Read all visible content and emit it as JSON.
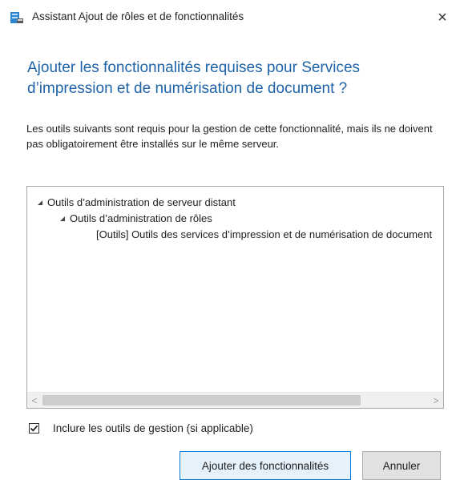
{
  "window": {
    "title": "Assistant Ajout de rôles et de fonctionnalités",
    "close_glyph": "×",
    "icon": "server-manager-icon"
  },
  "dialog": {
    "heading": "Ajouter les fonctionnalités requises pour Services d’impression et de numérisation de document ?",
    "description": "Les outils suivants sont requis pour la gestion de cette fonctionnalité, mais ils ne doivent pas obligatoirement être installés sur le même serveur."
  },
  "tree": {
    "items": [
      {
        "label": "Outils d’administration de serveur distant",
        "level": 0,
        "expanded": true
      },
      {
        "label": "Outils d’administration de rôles",
        "level": 1,
        "expanded": true
      },
      {
        "label": "[Outils] Outils des services d’impression et de numérisation de document",
        "level": 2
      }
    ],
    "scroll_left_glyph": "<",
    "scroll_right_glyph": ">"
  },
  "include_tools": {
    "label": "Inclure les outils de gestion (si applicable)",
    "checked": true
  },
  "buttons": {
    "add_label": "Ajouter des fonctionnalités",
    "cancel_label": "Annuler"
  }
}
